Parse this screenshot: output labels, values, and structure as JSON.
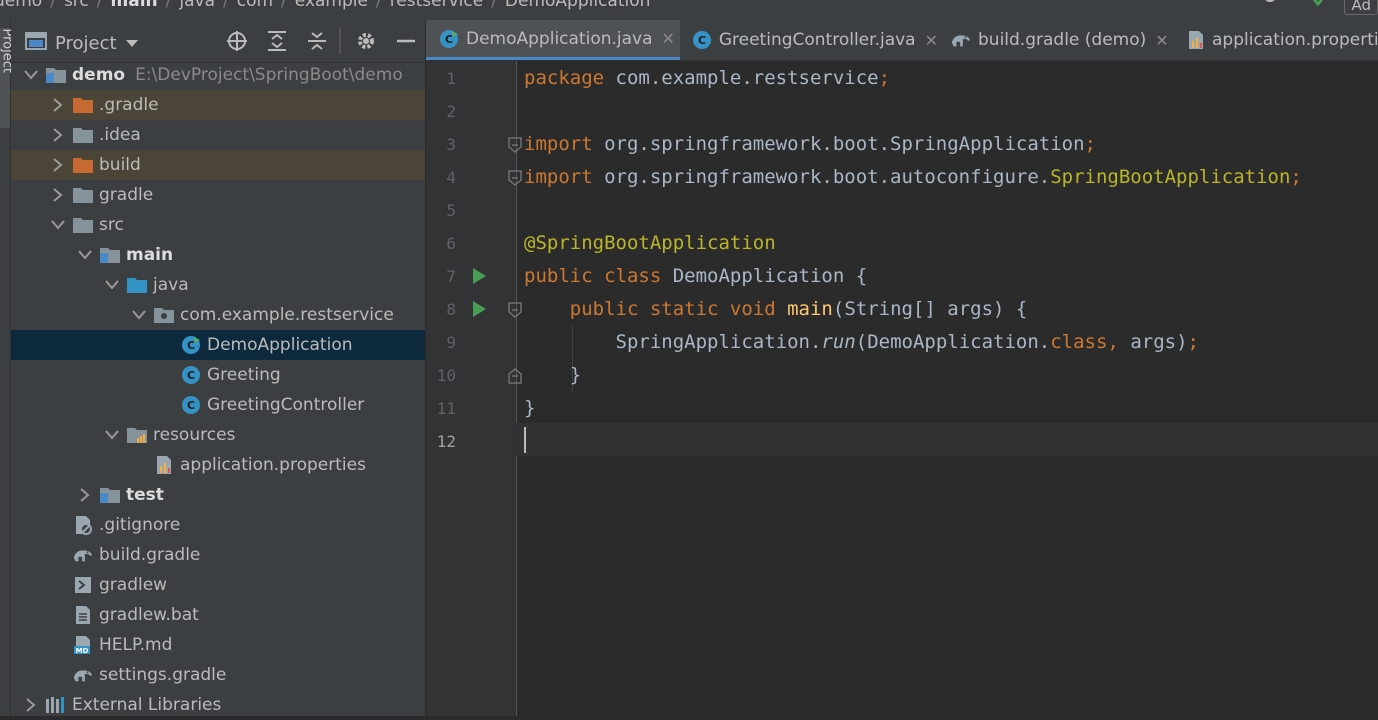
{
  "breadcrumb": [
    "demo",
    "src",
    "main",
    "java",
    "com",
    "example",
    "restservice",
    "DemoApplication"
  ],
  "navbar_right": {
    "add_label": "Ad"
  },
  "side_stripe": {
    "label": "Project"
  },
  "project_panel": {
    "title": "Project",
    "toolbar_icons": [
      "locate-icon",
      "expand-all-icon",
      "collapse-all-icon",
      "gear-icon",
      "hide-icon"
    ]
  },
  "tree": [
    {
      "label": "demo",
      "path": "E:\\DevProject\\SpringBoot\\demo",
      "depth": 0,
      "expanded": true,
      "icon": "module-folder",
      "bold": true
    },
    {
      "label": ".gradle",
      "depth": 1,
      "expanded": false,
      "icon": "folder-excluded",
      "excluded": true
    },
    {
      "label": ".idea",
      "depth": 1,
      "expanded": false,
      "icon": "folder"
    },
    {
      "label": "build",
      "depth": 1,
      "expanded": false,
      "icon": "folder-excluded",
      "excluded": true
    },
    {
      "label": "gradle",
      "depth": 1,
      "expanded": false,
      "icon": "folder"
    },
    {
      "label": "src",
      "depth": 1,
      "expanded": true,
      "icon": "folder"
    },
    {
      "label": "main",
      "depth": 2,
      "expanded": true,
      "icon": "module-folder",
      "bold": true
    },
    {
      "label": "java",
      "depth": 3,
      "expanded": true,
      "icon": "source-folder"
    },
    {
      "label": "com.example.restservice",
      "depth": 4,
      "expanded": true,
      "icon": "package"
    },
    {
      "label": "DemoApplication",
      "depth": 5,
      "icon": "class-run",
      "selected": true
    },
    {
      "label": "Greeting",
      "depth": 5,
      "icon": "class"
    },
    {
      "label": "GreetingController",
      "depth": 5,
      "icon": "class"
    },
    {
      "label": "resources",
      "depth": 3,
      "expanded": true,
      "icon": "resources-folder"
    },
    {
      "label": "application.properties",
      "depth": 4,
      "icon": "properties"
    },
    {
      "label": "test",
      "depth": 2,
      "expanded": false,
      "icon": "module-folder",
      "bold": true
    },
    {
      "label": ".gitignore",
      "depth": 1,
      "icon": "gitignore"
    },
    {
      "label": "build.gradle",
      "depth": 1,
      "icon": "gradle"
    },
    {
      "label": "gradlew",
      "depth": 1,
      "icon": "shell"
    },
    {
      "label": "gradlew.bat",
      "depth": 1,
      "icon": "file"
    },
    {
      "label": "HELP.md",
      "depth": 1,
      "icon": "markdown"
    },
    {
      "label": "settings.gradle",
      "depth": 1,
      "icon": "gradle"
    },
    {
      "label": "External Libraries",
      "depth": 0,
      "expanded": false,
      "icon": "libraries"
    }
  ],
  "tabs": [
    {
      "label": "DemoApplication.java",
      "icon": "class-run",
      "active": true,
      "closable": true
    },
    {
      "label": "GreetingController.java",
      "icon": "class",
      "active": false,
      "closable": true
    },
    {
      "label": "build.gradle (demo)",
      "icon": "gradle",
      "active": false,
      "closable": true
    },
    {
      "label": "application.properties",
      "icon": "properties",
      "active": false,
      "closable": false
    }
  ],
  "editor": {
    "current_line": 12,
    "run_gutter_lines": [
      7,
      8
    ],
    "fold_lines": [
      3,
      4,
      8,
      10
    ],
    "lines": [
      [
        {
          "t": "package ",
          "c": "kw"
        },
        {
          "t": "com.example.restservice"
        },
        {
          "t": ";",
          "c": "kw"
        }
      ],
      [],
      [
        {
          "t": "import ",
          "c": "kw"
        },
        {
          "t": "org.springframework.boot.SpringApplication"
        },
        {
          "t": ";",
          "c": "kw"
        }
      ],
      [
        {
          "t": "import ",
          "c": "kw"
        },
        {
          "t": "org.springframework.boot.autoconfigure."
        },
        {
          "t": "SpringBootApplication",
          "c": "ann"
        },
        {
          "t": ";",
          "c": "kw"
        }
      ],
      [],
      [
        {
          "t": "@SpringBootApplication",
          "c": "ann"
        }
      ],
      [
        {
          "t": "public class ",
          "c": "kw"
        },
        {
          "t": "DemoApplication {"
        }
      ],
      [
        {
          "t": "    "
        },
        {
          "t": "public static void ",
          "c": "kw"
        },
        {
          "t": "main",
          "c": "fn"
        },
        {
          "t": "(String[] args) {"
        }
      ],
      [
        {
          "t": "        SpringApplication."
        },
        {
          "t": "run",
          "c": "it"
        },
        {
          "t": "(DemoApplication."
        },
        {
          "t": "class",
          "c": "kw"
        },
        {
          "t": ", ",
          "c": "kw"
        },
        {
          "t": "args)"
        },
        {
          "t": ";",
          "c": "kw"
        }
      ],
      [
        {
          "t": "    }"
        }
      ],
      [
        {
          "t": "}"
        }
      ],
      []
    ]
  },
  "colors": {
    "accent": "#4a88c7",
    "selection": "#0d293e",
    "excluded": "#4a4537",
    "run_green": "#499c54"
  }
}
